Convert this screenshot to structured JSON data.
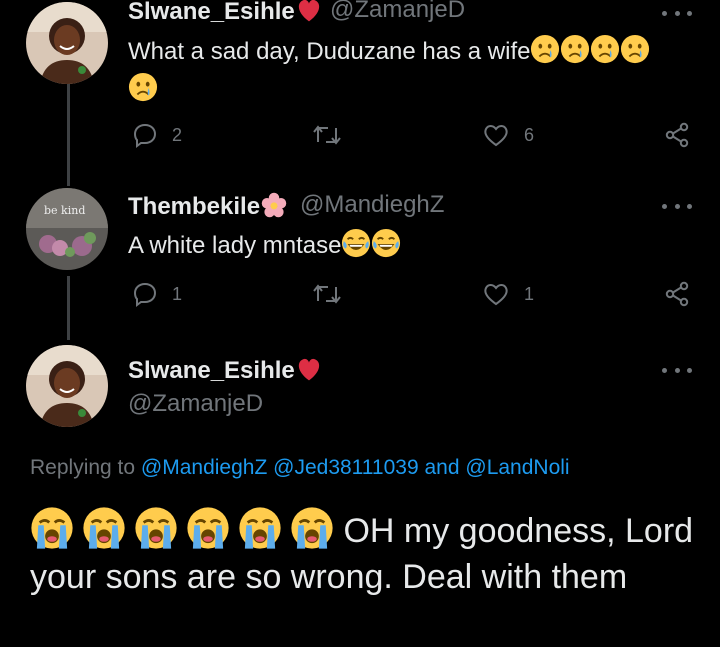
{
  "tweets": [
    {
      "name": "Slwane_Esihle",
      "handle": "@ZamanjeD",
      "text": "What a sad day, Duduzane has a wife",
      "actions": {
        "replies": "2",
        "retweets": "",
        "likes": "6"
      }
    },
    {
      "name": "Thembekile",
      "handle": "@MandieghZ",
      "avatar_text": "be kind",
      "text": "A white lady mntase",
      "actions": {
        "replies": "1",
        "retweets": "",
        "likes": "1"
      }
    }
  ],
  "main_tweet": {
    "name": "Slwane_Esihle",
    "handle": "@ZamanjeD",
    "replying_prefix": "Replying to",
    "mention_1": "@MandieghZ",
    "mention_2": "@Jed38111039",
    "and_word": "and",
    "mention_3": "@LandNoli",
    "text": "OH my goodness, Lord your sons are so wrong. Deal with them"
  },
  "colors": {
    "background": "#000000",
    "text": "#e7e9ea",
    "muted": "#71767b",
    "link": "#1d9bf0",
    "heart": "#f91880"
  },
  "icons": [
    "reply-icon",
    "retweet-icon",
    "like-icon",
    "share-icon",
    "more-icon",
    "crying-emoji",
    "sobbing-emoji",
    "laughing-emoji",
    "red-heart-emoji",
    "flower-emoji"
  ]
}
